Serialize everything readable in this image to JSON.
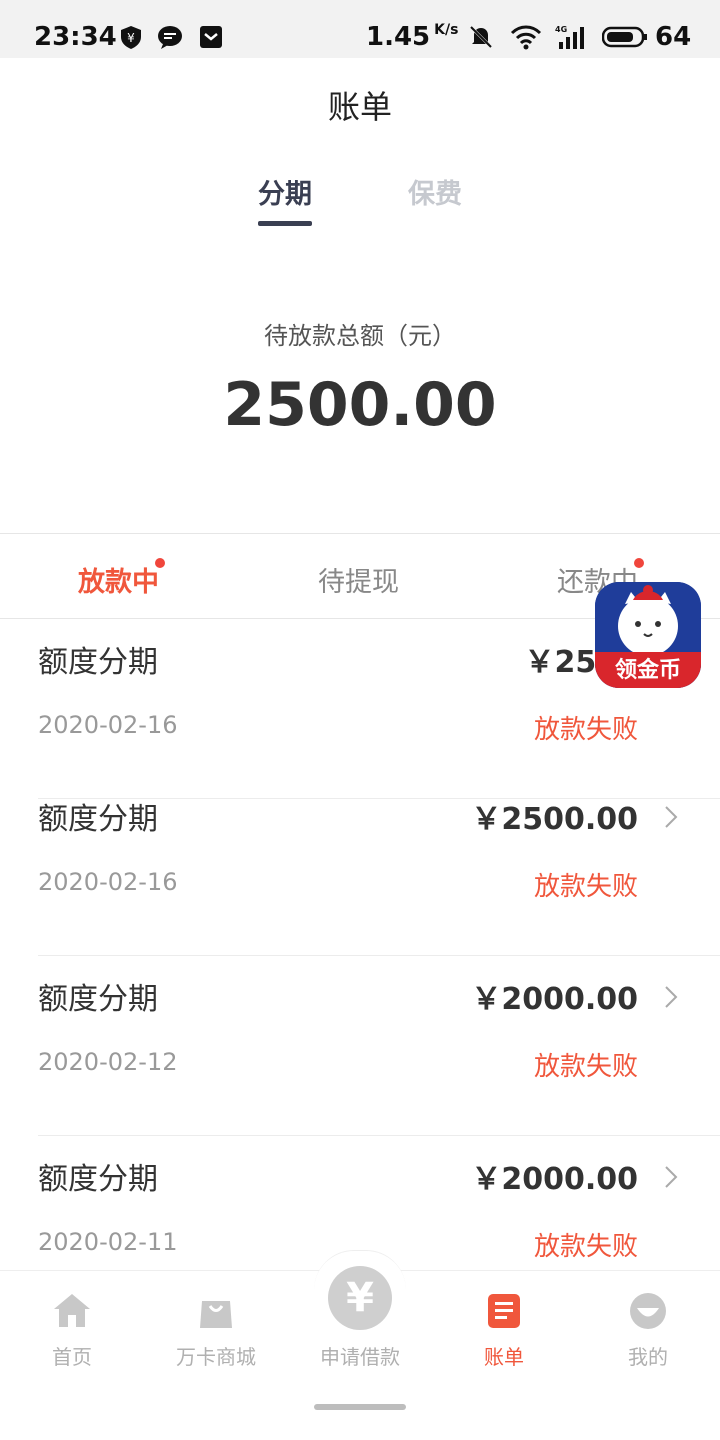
{
  "status_bar": {
    "time": "23:34",
    "speed": "1.45",
    "speed_unit": "K/s",
    "battery": "64"
  },
  "header": {
    "title": "账单"
  },
  "top_tabs": [
    {
      "label": "分期",
      "active": true
    },
    {
      "label": "保费",
      "active": false
    }
  ],
  "summary": {
    "label": "待放款总额（元）",
    "amount": "2500.00"
  },
  "sub_tabs": [
    {
      "label": "放款中",
      "active": true,
      "dot": true
    },
    {
      "label": "待提现",
      "active": false,
      "dot": false
    },
    {
      "label": "还款中",
      "active": false,
      "dot": true
    }
  ],
  "items": [
    {
      "name": "额度分期",
      "amount": "￥2500",
      "date": "2020-02-16",
      "status": "放款失败"
    },
    {
      "name": "额度分期",
      "amount": "￥2500.00",
      "date": "2020-02-16",
      "status": "放款失败"
    },
    {
      "name": "额度分期",
      "amount": "￥2000.00",
      "date": "2020-02-12",
      "status": "放款失败"
    },
    {
      "name": "额度分期",
      "amount": "￥2000.00",
      "date": "2020-02-11",
      "status": "放款失败"
    }
  ],
  "float_badge": {
    "text": "领金币"
  },
  "bottom_nav": [
    {
      "label": "首页",
      "icon": "home-icon",
      "active": false
    },
    {
      "label": "万卡商城",
      "icon": "shopping-bag-icon",
      "active": false
    },
    {
      "label": "申请借款",
      "icon": "yen-icon",
      "active": false
    },
    {
      "label": "账单",
      "icon": "bill-icon",
      "active": true
    },
    {
      "label": "我的",
      "icon": "profile-icon",
      "active": false
    }
  ],
  "colors": {
    "accent": "#f0573c",
    "tab_dark": "#3a3f52"
  }
}
